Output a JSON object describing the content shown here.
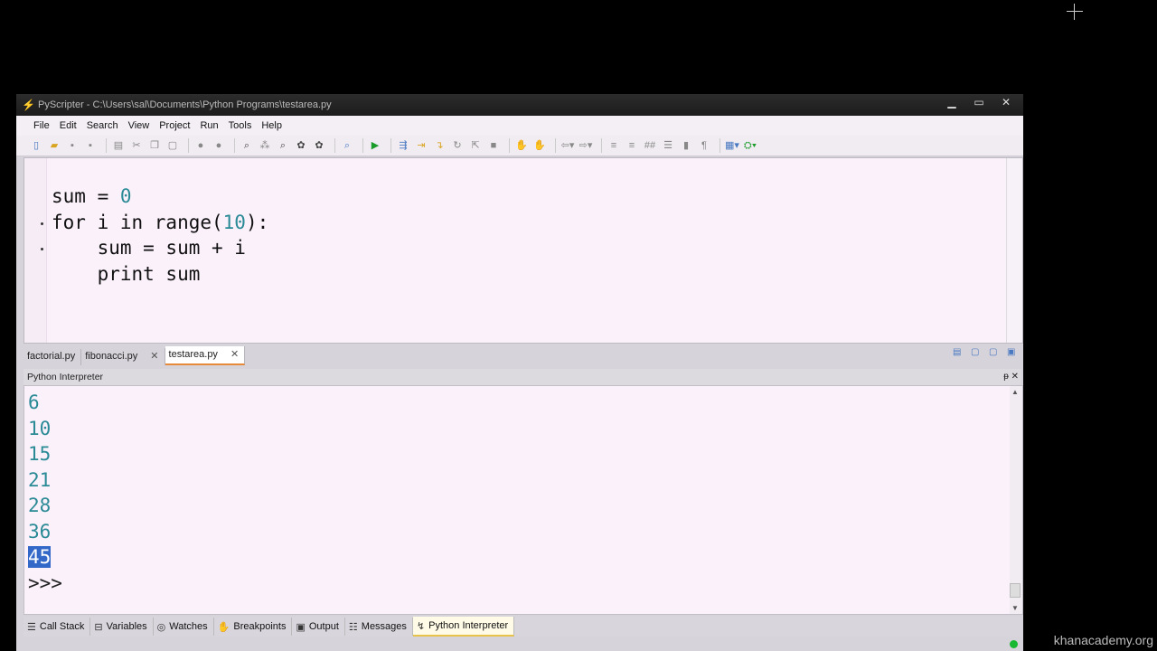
{
  "window": {
    "title": "PyScripter - C:\\Users\\sal\\Documents\\Python Programs\\testarea.py",
    "controls": [
      "▁",
      "▭",
      "✕"
    ]
  },
  "menu": [
    "File",
    "Edit",
    "Search",
    "View",
    "Project",
    "Run",
    "Tools",
    "Help"
  ],
  "editor": {
    "lines": [
      [
        {
          "t": "sum = "
        },
        {
          "t": "0",
          "c": "num"
        }
      ],
      [
        {
          "t": "for i in range("
        },
        {
          "t": "10",
          "c": "num"
        },
        {
          "t": "):"
        }
      ],
      [
        {
          "t": "    sum = sum + i"
        }
      ],
      [
        {
          "t": "    print sum"
        }
      ]
    ]
  },
  "tabs": [
    {
      "label": "factorial.py",
      "active": false
    },
    {
      "label": "fibonacci.py",
      "active": false
    },
    {
      "label": "testarea.py",
      "active": true
    }
  ],
  "interpreter": {
    "title": "Python Interpreter",
    "header_buttons": "ᵽ ✕",
    "output": [
      "6",
      "10",
      "15",
      "21",
      "28",
      "36"
    ],
    "selected_output": "45",
    "prompt": ">>>"
  },
  "bottom_tabs": [
    {
      "label": "Call Stack",
      "icon": "☰"
    },
    {
      "label": "Variables",
      "icon": "⊟"
    },
    {
      "label": "Watches",
      "icon": "◎"
    },
    {
      "label": "Breakpoints",
      "icon": "✋"
    },
    {
      "label": "Output",
      "icon": "▣"
    },
    {
      "label": "Messages",
      "icon": "☷"
    },
    {
      "label": "Python Interpreter",
      "icon": "↯",
      "active": true
    }
  ],
  "watermark": "khanacademy.org",
  "colors": {
    "number": "#2a8a95",
    "selection": "#3368c9",
    "active_tab": "#e78a3a",
    "status_led": "#18b832"
  }
}
